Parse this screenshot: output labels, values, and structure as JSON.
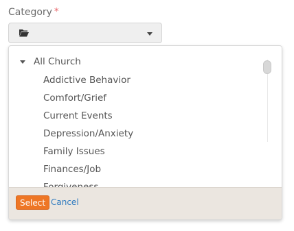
{
  "field": {
    "label": "Category",
    "required_marker": "*"
  },
  "picker": {
    "toggle_icon": "folder-open-icon",
    "caret_icon": "caret-down-icon"
  },
  "tree": {
    "root_label": "All Church",
    "items": [
      "Addictive Behavior",
      "Comfort/Grief",
      "Current Events",
      "Depression/Anxiety",
      "Family Issues",
      "Finances/Job",
      "Forgiveness"
    ]
  },
  "footer": {
    "select_label": "Select",
    "cancel_label": "Cancel"
  },
  "colors": {
    "accent": "#ee7625",
    "link": "#2f7bbf",
    "required": "#e8656a",
    "footer_bg": "#ebe6e0"
  }
}
